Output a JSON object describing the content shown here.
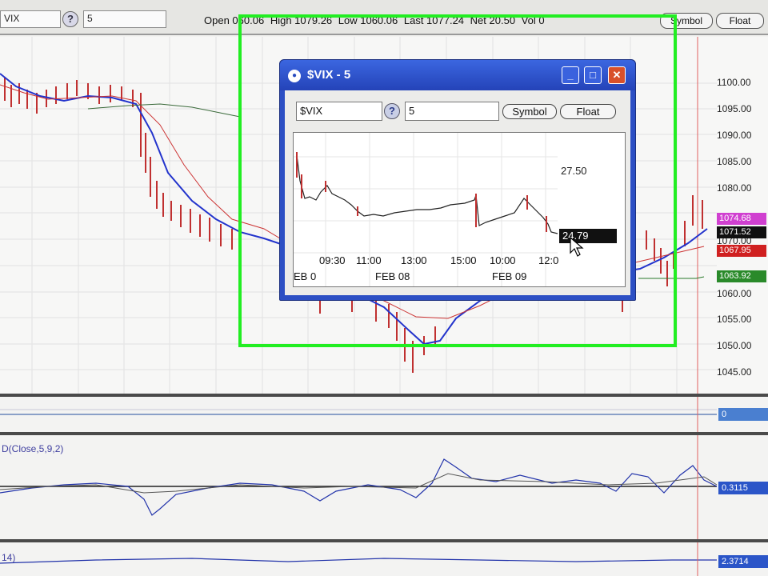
{
  "toolbar": {
    "symbol_value": "VIX",
    "help_label": "?",
    "interval_value": "5",
    "quote": {
      "open": "Open 060.06",
      "high": "High 1079.26",
      "low": "Low 1060.06",
      "last": "Last 1077.24",
      "net": "Net 20.50",
      "vol": "Vol 0"
    },
    "symbol_button": "Symbol",
    "float_button": "Float"
  },
  "price_axis": {
    "labels": [
      "1100.00",
      "1095.00",
      "1090.00",
      "1085.00",
      "1080.00",
      "1075.00",
      "1070.00",
      "1065.00",
      "1060.00",
      "1055.00",
      "1050.00",
      "1045.00"
    ],
    "badges": [
      {
        "text": "1074.68",
        "color": "#d040d0"
      },
      {
        "text": "1071.52",
        "color": "#101010"
      },
      {
        "text": "1067.95",
        "color": "#d02020"
      },
      {
        "text": "1063.92",
        "color": "#2a8a2a"
      }
    ]
  },
  "indicator_panels": {
    "panel1_badge": {
      "text": "0",
      "color": "#4a7fd0"
    },
    "panel2_label": "D(Close,5,9,2)",
    "panel2_badge": {
      "text": "0.3115",
      "color": "#2b55c8"
    },
    "panel3_label": "14)",
    "panel3_badge": {
      "text": "2.3714",
      "color": "#2b55c8"
    }
  },
  "float_window": {
    "title": "$VIX - 5",
    "symbol_value": "$VIX",
    "help_label": "?",
    "interval_value": "5",
    "symbol_button": "Symbol",
    "float_button": "Float",
    "price_label": "27.50",
    "last_price": "24.79",
    "time_ticks": [
      "09:30",
      "11:00",
      "13:00",
      "15:00",
      "10:00",
      "12:0"
    ],
    "date_ticks": [
      "EB 0",
      "FEB 08",
      "FEB 09"
    ]
  },
  "colors": {
    "highlight": "#22ee22",
    "window_frame": "#2c4fc4",
    "ma_blue": "#2233cc",
    "ma_red": "#cc2222",
    "candles": "#cc2222"
  }
}
